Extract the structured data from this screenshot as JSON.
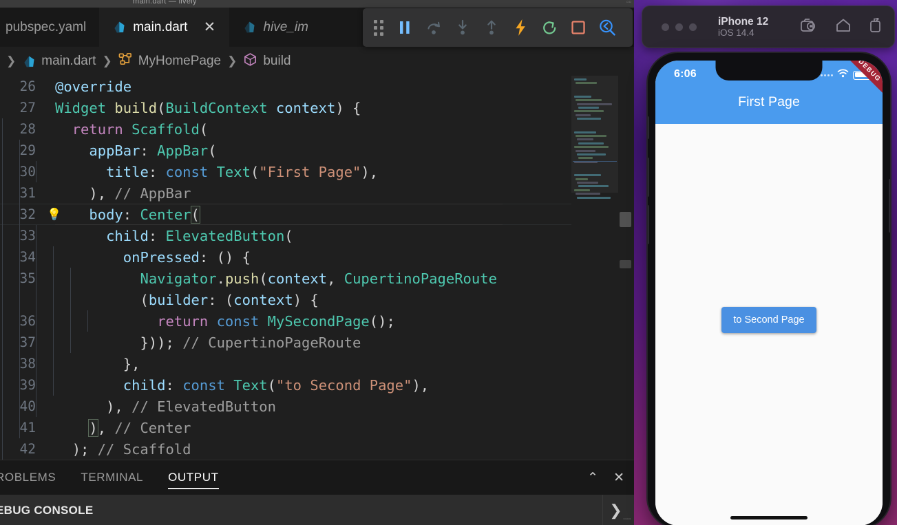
{
  "window": {
    "titlebar_text": "main.dart — lively",
    "titlebar_dots": "▫▫"
  },
  "tabs": [
    {
      "label": "pubspec.yaml",
      "icon": "",
      "active": false,
      "preview": false,
      "closable": false
    },
    {
      "label": "main.dart",
      "icon": "dart-icon",
      "active": true,
      "preview": false,
      "closable": true,
      "close_label": "✕"
    },
    {
      "label": "hive_im",
      "icon": "dart-icon",
      "active": false,
      "preview": true,
      "closable": false
    }
  ],
  "breadcrumb": {
    "leading_sep": "❯",
    "items": [
      {
        "label": "main.dart",
        "icon": "dart-icon"
      },
      {
        "label": "MyHomePage",
        "icon": "class-icon"
      },
      {
        "label": "build",
        "icon": "method-icon"
      }
    ],
    "separator": "❯"
  },
  "debug_toolbar": {
    "grip_name": "drag-handle",
    "buttons": [
      {
        "name": "pause-button",
        "tooltip": "Pause",
        "icon": "pause",
        "color": "#75beff"
      },
      {
        "name": "step-over-button",
        "tooltip": "Step Over",
        "icon": "step-over",
        "color": "#5a6670"
      },
      {
        "name": "step-into-button",
        "tooltip": "Step Into",
        "icon": "step-into",
        "color": "#5a6670"
      },
      {
        "name": "step-out-button",
        "tooltip": "Step Out",
        "icon": "step-out",
        "color": "#5a6670"
      },
      {
        "name": "hot-reload-button",
        "tooltip": "Hot Reload",
        "icon": "lightning",
        "color": "#f5a623"
      },
      {
        "name": "hot-restart-button",
        "tooltip": "Hot Restart",
        "icon": "restart",
        "color": "#73c991"
      },
      {
        "name": "stop-button",
        "tooltip": "Stop",
        "icon": "stop",
        "color": "#e8836b"
      },
      {
        "name": "inspector-button",
        "tooltip": "Flutter Inspector",
        "icon": "inspect",
        "color": "#3794ff"
      }
    ]
  },
  "editor": {
    "code_lines": [
      {
        "num": "26",
        "indent": 0,
        "guides": [],
        "tokens": [
          {
            "t": "@override",
            "c": "t-ann"
          }
        ]
      },
      {
        "num": "27",
        "indent": 0,
        "guides": [],
        "tokens": [
          {
            "t": "Widget",
            "c": "t-type"
          },
          {
            "t": " ",
            "c": "t-plain"
          },
          {
            "t": "build",
            "c": "t-fn"
          },
          {
            "t": "(",
            "c": "t-plain"
          },
          {
            "t": "BuildContext",
            "c": "t-type"
          },
          {
            "t": " ",
            "c": "t-plain"
          },
          {
            "t": "context",
            "c": "t-var"
          },
          {
            "t": ") {",
            "c": "t-plain"
          }
        ]
      },
      {
        "num": "28",
        "indent": 1,
        "guides": [
          0
        ],
        "tokens": [
          {
            "t": "return",
            "c": "t-kw"
          },
          {
            "t": " ",
            "c": "t-plain"
          },
          {
            "t": "Scaffold",
            "c": "t-type"
          },
          {
            "t": "(",
            "c": "t-plain"
          }
        ]
      },
      {
        "num": "29",
        "indent": 2,
        "guides": [
          0,
          1
        ],
        "tokens": [
          {
            "t": "appBar",
            "c": "t-var"
          },
          {
            "t": ": ",
            "c": "t-plain"
          },
          {
            "t": "AppBar",
            "c": "t-type"
          },
          {
            "t": "(",
            "c": "t-plain"
          }
        ]
      },
      {
        "num": "30",
        "indent": 3,
        "guides": [
          0,
          1,
          2
        ],
        "tokens": [
          {
            "t": "title",
            "c": "t-var"
          },
          {
            "t": ": ",
            "c": "t-plain"
          },
          {
            "t": "const",
            "c": "t-kw2"
          },
          {
            "t": " ",
            "c": "t-plain"
          },
          {
            "t": "Text",
            "c": "t-type"
          },
          {
            "t": "(",
            "c": "t-plain"
          },
          {
            "t": "\"First Page\"",
            "c": "t-str"
          },
          {
            "t": "),",
            "c": "t-plain"
          }
        ]
      },
      {
        "num": "31",
        "indent": 2,
        "guides": [
          0,
          1
        ],
        "tokens": [
          {
            "t": "), ",
            "c": "t-plain"
          },
          {
            "t": "// AppBar",
            "c": "t-cmt"
          }
        ]
      },
      {
        "num": "32",
        "indent": 2,
        "guides": [
          0,
          1
        ],
        "bulb": "💡",
        "focus": true,
        "tokens": [
          {
            "t": "body",
            "c": "t-var"
          },
          {
            "t": ": ",
            "c": "t-plain"
          },
          {
            "t": "Center",
            "c": "t-type"
          },
          {
            "t": "(",
            "c": "t-plain",
            "match": true
          }
        ]
      },
      {
        "num": "33",
        "indent": 3,
        "guides": [
          0,
          1,
          2
        ],
        "tokens": [
          {
            "t": "child",
            "c": "t-var"
          },
          {
            "t": ": ",
            "c": "t-plain"
          },
          {
            "t": "ElevatedButton",
            "c": "t-type"
          },
          {
            "t": "(",
            "c": "t-plain"
          }
        ]
      },
      {
        "num": "34",
        "indent": 4,
        "guides": [
          0,
          1,
          2,
          3
        ],
        "tokens": [
          {
            "t": "onPressed",
            "c": "t-var"
          },
          {
            "t": ": () {",
            "c": "t-plain"
          }
        ]
      },
      {
        "num": "35",
        "indent": 5,
        "guides": [
          0,
          1,
          2,
          3,
          4
        ],
        "tokens": [
          {
            "t": "Navigator",
            "c": "t-type"
          },
          {
            "t": ".",
            "c": "t-plain"
          },
          {
            "t": "push",
            "c": "t-fn"
          },
          {
            "t": "(",
            "c": "t-plain"
          },
          {
            "t": "context",
            "c": "t-var"
          },
          {
            "t": ", ",
            "c": "t-plain"
          },
          {
            "t": "CupertinoPageRoute",
            "c": "t-type"
          }
        ]
      },
      {
        "num": "",
        "indent": 5,
        "guides": [
          0,
          1,
          2,
          3,
          4
        ],
        "tokens": [
          {
            "t": "(",
            "c": "t-plain"
          },
          {
            "t": "builder",
            "c": "t-var"
          },
          {
            "t": ": (",
            "c": "t-plain"
          },
          {
            "t": "context",
            "c": "t-var"
          },
          {
            "t": ") {",
            "c": "t-plain"
          }
        ]
      },
      {
        "num": "36",
        "indent": 6,
        "guides": [
          0,
          1,
          2,
          3,
          4,
          5
        ],
        "tokens": [
          {
            "t": "return",
            "c": "t-kw"
          },
          {
            "t": " ",
            "c": "t-plain"
          },
          {
            "t": "const",
            "c": "t-kw2"
          },
          {
            "t": " ",
            "c": "t-plain"
          },
          {
            "t": "MySecondPage",
            "c": "t-type"
          },
          {
            "t": "();",
            "c": "t-plain"
          }
        ]
      },
      {
        "num": "37",
        "indent": 5,
        "guides": [
          0,
          1,
          2,
          3,
          4
        ],
        "tokens": [
          {
            "t": "})); ",
            "c": "t-plain"
          },
          {
            "t": "// CupertinoPageRoute",
            "c": "t-cmt"
          }
        ]
      },
      {
        "num": "38",
        "indent": 4,
        "guides": [
          0,
          1,
          2,
          3
        ],
        "tokens": [
          {
            "t": "},",
            "c": "t-plain"
          }
        ]
      },
      {
        "num": "39",
        "indent": 4,
        "guides": [
          0,
          1,
          2,
          3
        ],
        "tokens": [
          {
            "t": "child",
            "c": "t-var"
          },
          {
            "t": ": ",
            "c": "t-plain"
          },
          {
            "t": "const",
            "c": "t-kw2"
          },
          {
            "t": " ",
            "c": "t-plain"
          },
          {
            "t": "Text",
            "c": "t-type"
          },
          {
            "t": "(",
            "c": "t-plain"
          },
          {
            "t": "\"to Second Page\"",
            "c": "t-str"
          },
          {
            "t": "),",
            "c": "t-plain"
          }
        ]
      },
      {
        "num": "40",
        "indent": 3,
        "guides": [
          0,
          1,
          2
        ],
        "tokens": [
          {
            "t": "), ",
            "c": "t-plain"
          },
          {
            "t": "// ElevatedButton",
            "c": "t-cmt"
          }
        ]
      },
      {
        "num": "41",
        "indent": 2,
        "guides": [
          0,
          1
        ],
        "tokens": [
          {
            "t": ")",
            "c": "t-plain",
            "match": true
          },
          {
            "t": ", ",
            "c": "t-plain"
          },
          {
            "t": "// Center",
            "c": "t-cmt"
          }
        ]
      },
      {
        "num": "42",
        "indent": 1,
        "guides": [
          0
        ],
        "tokens": [
          {
            "t": "); ",
            "c": "t-plain"
          },
          {
            "t": "// Scaffold",
            "c": "t-cmt"
          }
        ]
      }
    ]
  },
  "panel": {
    "tabs": [
      {
        "label": "ROBLEMS",
        "active": false
      },
      {
        "label": "TERMINAL",
        "active": false
      },
      {
        "label": "OUTPUT",
        "active": true
      }
    ],
    "actions": [
      {
        "name": "collapse-panel-button",
        "glyph": "⌃"
      },
      {
        "name": "close-panel-button",
        "glyph": "✕"
      }
    ],
    "section_title": "EBUG CONSOLE",
    "section_chevron": "❯",
    "grip": "''''"
  },
  "simulator": {
    "device_name": "iPhone 12",
    "os_version": "iOS 14.4",
    "window_dots": 3,
    "toolbar_icons": [
      {
        "name": "screenshot-icon"
      },
      {
        "name": "home-icon"
      },
      {
        "name": "rotate-icon"
      }
    ],
    "status_bar": {
      "time": "6:06",
      "wifi": "wifi-icon",
      "battery": "battery-icon"
    },
    "app": {
      "appbar_title": "First Page",
      "appbar_color": "#4a9bee",
      "debug_banner": "DEBUG",
      "button_label": "to Second Page",
      "button_color": "#4a90e2",
      "body_color": "#fafafa"
    }
  },
  "colors": {
    "editor_bg": "#1f1f1f",
    "tabbar_bg": "#181818",
    "panel_bg": "#181818",
    "section_bg": "#2d2d2d",
    "accent_blue": "#3794ff",
    "string_orange": "#ce9178",
    "type_teal": "#4ec9b0",
    "keyword_purple": "#c586c0",
    "wallpaper": "#4a1d86"
  }
}
